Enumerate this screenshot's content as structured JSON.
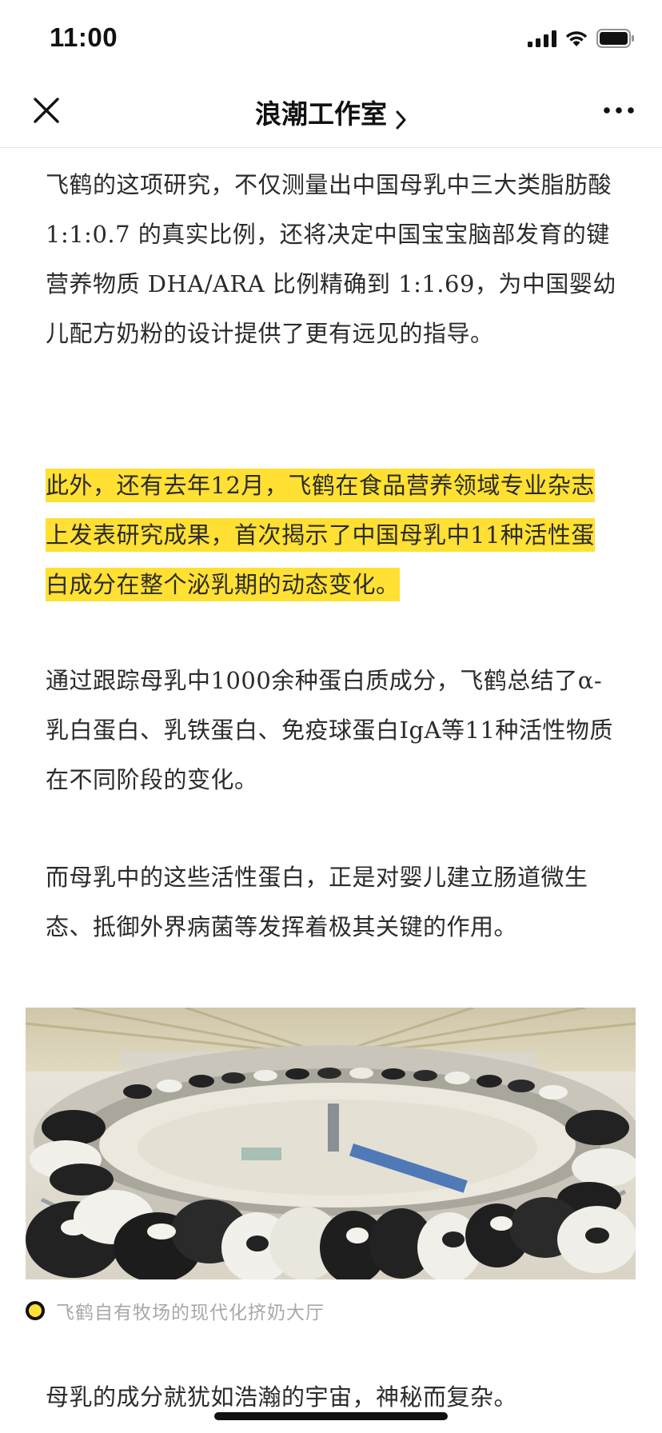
{
  "status_bar": {
    "time": "11:00",
    "icons": [
      "cellular-signal-icon",
      "wifi-icon",
      "battery-icon"
    ]
  },
  "nav": {
    "close_icon": "close-icon",
    "title": "浪潮工作室",
    "title_icon": "chevron-right-icon",
    "more_icon": "more-dots-icon"
  },
  "article": {
    "paragraph_1": "飞鹤的这项研究，不仅测量出中国母乳中三大类脂肪酸 1:1:0.7 的真实比例，还将决定中国宝宝脑部发育的键营养物质 DHA/ARA 比例精确到 1:1.69，为中国婴幼儿配方奶粉的设计提供了更有远见的指导。",
    "paragraph_2_highlighted": "此外，还有去年12月，飞鹤在食品营养领域专业杂志上发表研究成果，首次揭示了中国母乳中11种活性蛋白成分在整个泌乳期的动态变化。",
    "paragraph_3": "通过跟踪母乳中1000余种蛋白质成分，飞鹤总结了α-乳白蛋白、乳铁蛋白、免疫球蛋白IgA等11种活性物质在不同阶段的变化。",
    "paragraph_4": "而母乳中的这些活性蛋白，正是对婴儿建立肠道微生态、抵御外界病菌等发挥着极其关键的作用。",
    "image_caption": "飞鹤自有牧场的现代化挤奶大厅",
    "paragraph_5": "母乳的成分就犹如浩瀚的宇宙，神秘而复杂。"
  },
  "colors": {
    "highlight": "#ffe033",
    "text": "#2b2b2b",
    "caption": "#a8a8a8"
  }
}
